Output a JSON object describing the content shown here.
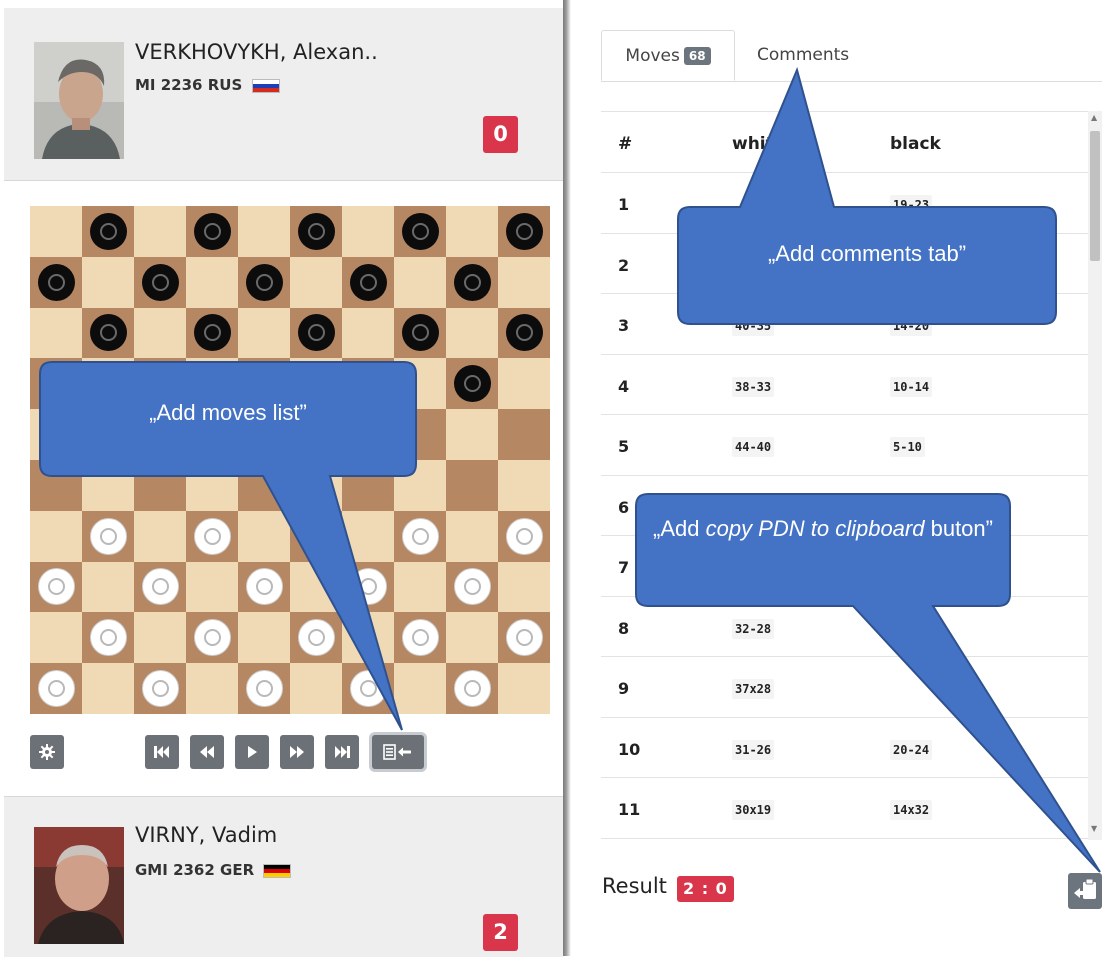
{
  "players": {
    "top": {
      "name": "VERKHOVYKH, Alexan..",
      "title": "MI",
      "rating": "2236",
      "country": "RUS",
      "score": "0"
    },
    "bottom": {
      "name": "VIRNY, Vadim",
      "title": "GMI",
      "rating": "2362",
      "country": "GER",
      "score": "2"
    }
  },
  "board": {
    "light_color": "#f0dab6",
    "dark_color": "#b58863",
    "rows": [
      ".b.b.b.b.b",
      "b.b.b.b.b.",
      ".b.b.b.b.b",
      "........b.",
      "..........",
      "..........",
      ".w.w...w.w",
      "w.w.w.w.w.",
      ".w.w.w.w.w",
      "w.w.w.w.w."
    ]
  },
  "controls": {
    "settings": "gear-icon",
    "first": "skip-back-icon",
    "prev": "rewind-icon",
    "play": "play-icon",
    "next": "fast-forward-icon",
    "last": "skip-forward-icon",
    "moves_list": "list-arrow-icon"
  },
  "tabs": {
    "moves_label": "Moves",
    "moves_count": "68",
    "comments_label": "Comments"
  },
  "moves_table": {
    "headers": [
      "#",
      "white",
      "black"
    ],
    "rows": [
      {
        "n": "1",
        "white": "",
        "black": "19-23"
      },
      {
        "n": "2",
        "white": "",
        "black": ""
      },
      {
        "n": "3",
        "white": "40-35",
        "black": "14-20"
      },
      {
        "n": "4",
        "white": "38-33",
        "black": "10-14"
      },
      {
        "n": "5",
        "white": "44-40",
        "black": "5-10"
      },
      {
        "n": "6",
        "white": "",
        "black": ""
      },
      {
        "n": "7",
        "white": "",
        "black": ""
      },
      {
        "n": "8",
        "white": "32-28",
        "black": ""
      },
      {
        "n": "9",
        "white": "37x28",
        "black": ""
      },
      {
        "n": "10",
        "white": "31-26",
        "black": "20-24"
      },
      {
        "n": "11",
        "white": "30x19",
        "black": "14x32"
      }
    ]
  },
  "result": {
    "label": "Result",
    "score": "2 : 0"
  },
  "callouts": {
    "comments_tab": "„Add comments tab”",
    "moves_list": "„Add moves list”",
    "copy_pdn_prefix": "„Add ",
    "copy_pdn_italic": "copy PDN to clipboard",
    "copy_pdn_suffix": " buton”",
    "fill_color": "#4472c4",
    "stroke_color": "#2f528f"
  },
  "colors": {
    "badge_red": "#d9364b",
    "button_gray": "#6c7178"
  }
}
